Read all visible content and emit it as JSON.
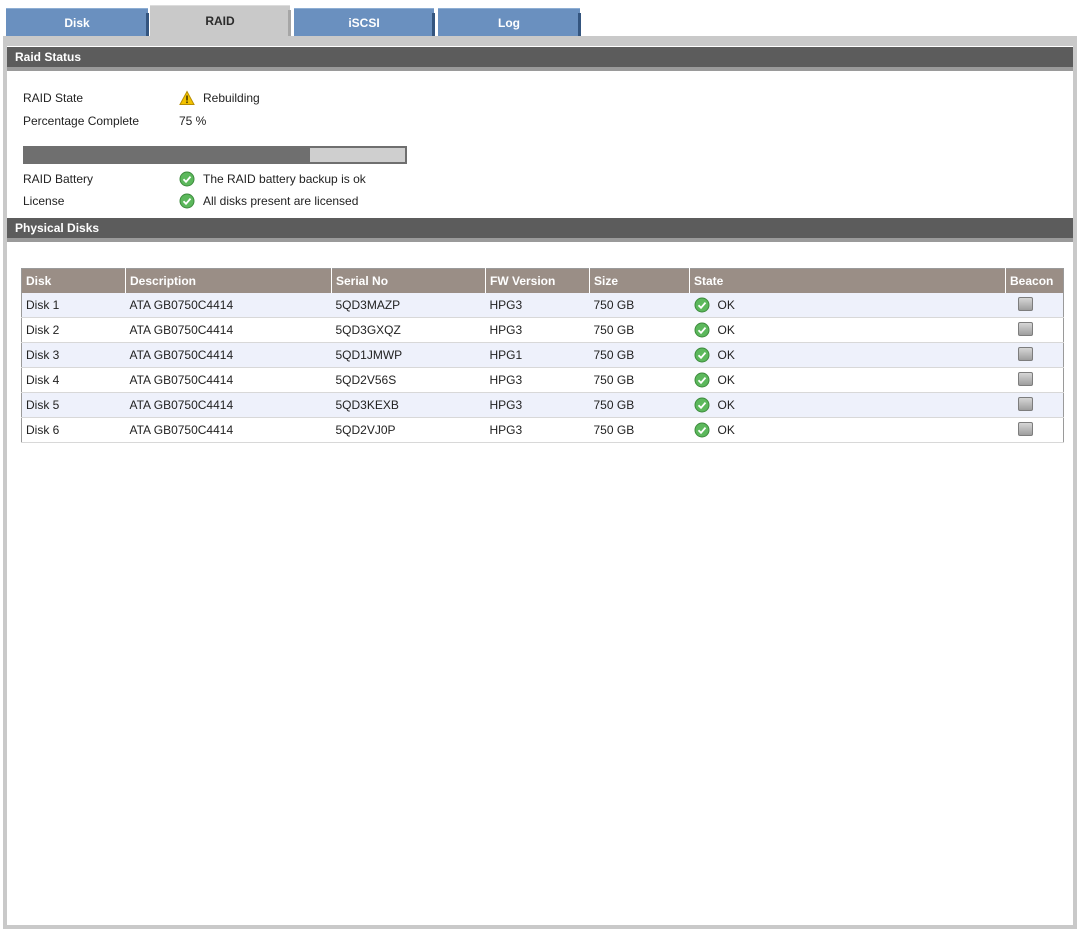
{
  "tabs": [
    {
      "label": "Disk"
    },
    {
      "label": "RAID"
    },
    {
      "label": "iSCSI"
    },
    {
      "label": "Log"
    }
  ],
  "raid_status": {
    "title": "Raid Status",
    "state_label": "RAID State",
    "state_value": "Rebuilding",
    "percent_label": "Percentage Complete",
    "percent_value": "75 %",
    "progress_fraction": 0.75,
    "battery_label": "RAID Battery",
    "battery_value": "The RAID battery backup is ok",
    "license_label": "License",
    "license_value": "All disks present are licensed",
    "icons": {
      "state": "warning-icon",
      "battery": "check-circle-icon",
      "license": "check-circle-icon"
    }
  },
  "physical_disks": {
    "title": "Physical Disks",
    "columns": [
      "Disk",
      "Description",
      "Serial No",
      "FW Version",
      "Size",
      "State",
      "Beacon"
    ],
    "rows": [
      {
        "disk": "Disk 1",
        "description": "ATA GB0750C4414",
        "serial": "5QD3MAZP",
        "fw": "HPG3",
        "size": "750 GB",
        "state": "OK"
      },
      {
        "disk": "Disk 2",
        "description": "ATA GB0750C4414",
        "serial": "5QD3GXQZ",
        "fw": "HPG3",
        "size": "750 GB",
        "state": "OK"
      },
      {
        "disk": "Disk 3",
        "description": "ATA GB0750C4414",
        "serial": "5QD1JMWP",
        "fw": "HPG1",
        "size": "750 GB",
        "state": "OK"
      },
      {
        "disk": "Disk 4",
        "description": "ATA GB0750C4414",
        "serial": "5QD2V56S",
        "fw": "HPG3",
        "size": "750 GB",
        "state": "OK"
      },
      {
        "disk": "Disk 5",
        "description": "ATA GB0750C4414",
        "serial": "5QD3KEXB",
        "fw": "HPG3",
        "size": "750 GB",
        "state": "OK"
      },
      {
        "disk": "Disk 6",
        "description": "ATA GB0750C4414",
        "serial": "5QD2VJ0P",
        "fw": "HPG3",
        "size": "750 GB",
        "state": "OK"
      }
    ]
  },
  "colors": {
    "tab_blue": "#6a90bf",
    "tab_active": "#c9c9c9",
    "section_header": "#5c5c5c",
    "table_header": "#9a8e86",
    "ok_green": "#5cb85c",
    "warning_yellow": "#f2c200"
  }
}
